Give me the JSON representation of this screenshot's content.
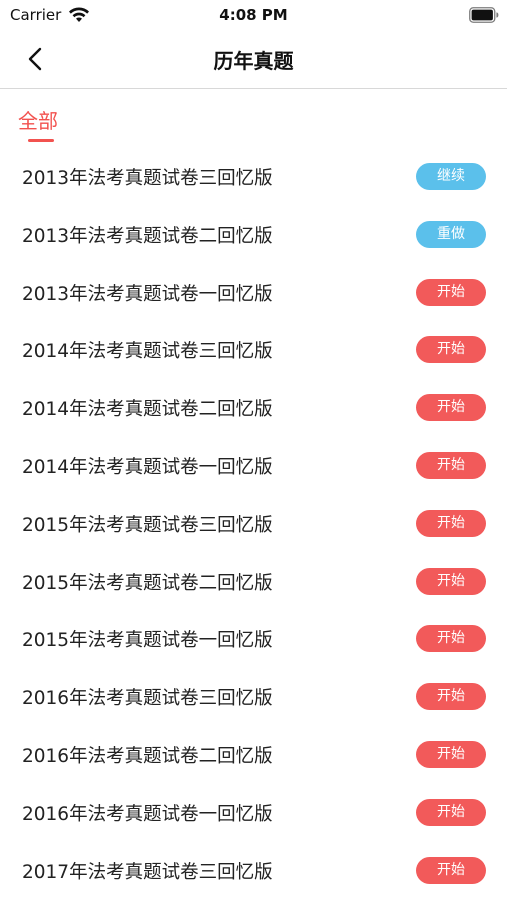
{
  "status_bar": {
    "carrier": "Carrier",
    "time": "4:08 PM",
    "wifi_icon": "wifi-icon",
    "battery_icon": "battery-icon"
  },
  "nav": {
    "title": "历年真题",
    "back_icon": "chevron-left-icon"
  },
  "tabs": [
    {
      "label": "全部",
      "active": true
    }
  ],
  "colors": {
    "accent_red": "#f2524f",
    "button_blue": "#5bc0eb",
    "button_red": "#f25a5a"
  },
  "items": [
    {
      "title": "2013年法考真题试卷三回忆版",
      "action": "继续",
      "style": "blue"
    },
    {
      "title": "2013年法考真题试卷二回忆版",
      "action": "重做",
      "style": "blue"
    },
    {
      "title": "2013年法考真题试卷一回忆版",
      "action": "开始",
      "style": "red"
    },
    {
      "title": "2014年法考真题试卷三回忆版",
      "action": "开始",
      "style": "red"
    },
    {
      "title": "2014年法考真题试卷二回忆版",
      "action": "开始",
      "style": "red"
    },
    {
      "title": "2014年法考真题试卷一回忆版",
      "action": "开始",
      "style": "red"
    },
    {
      "title": "2015年法考真题试卷三回忆版",
      "action": "开始",
      "style": "red"
    },
    {
      "title": "2015年法考真题试卷二回忆版",
      "action": "开始",
      "style": "red"
    },
    {
      "title": "2015年法考真题试卷一回忆版",
      "action": "开始",
      "style": "red"
    },
    {
      "title": "2016年法考真题试卷三回忆版",
      "action": "开始",
      "style": "red"
    },
    {
      "title": "2016年法考真题试卷二回忆版",
      "action": "开始",
      "style": "red"
    },
    {
      "title": "2016年法考真题试卷一回忆版",
      "action": "开始",
      "style": "red"
    },
    {
      "title": "2017年法考真题试卷三回忆版",
      "action": "开始",
      "style": "red"
    }
  ]
}
